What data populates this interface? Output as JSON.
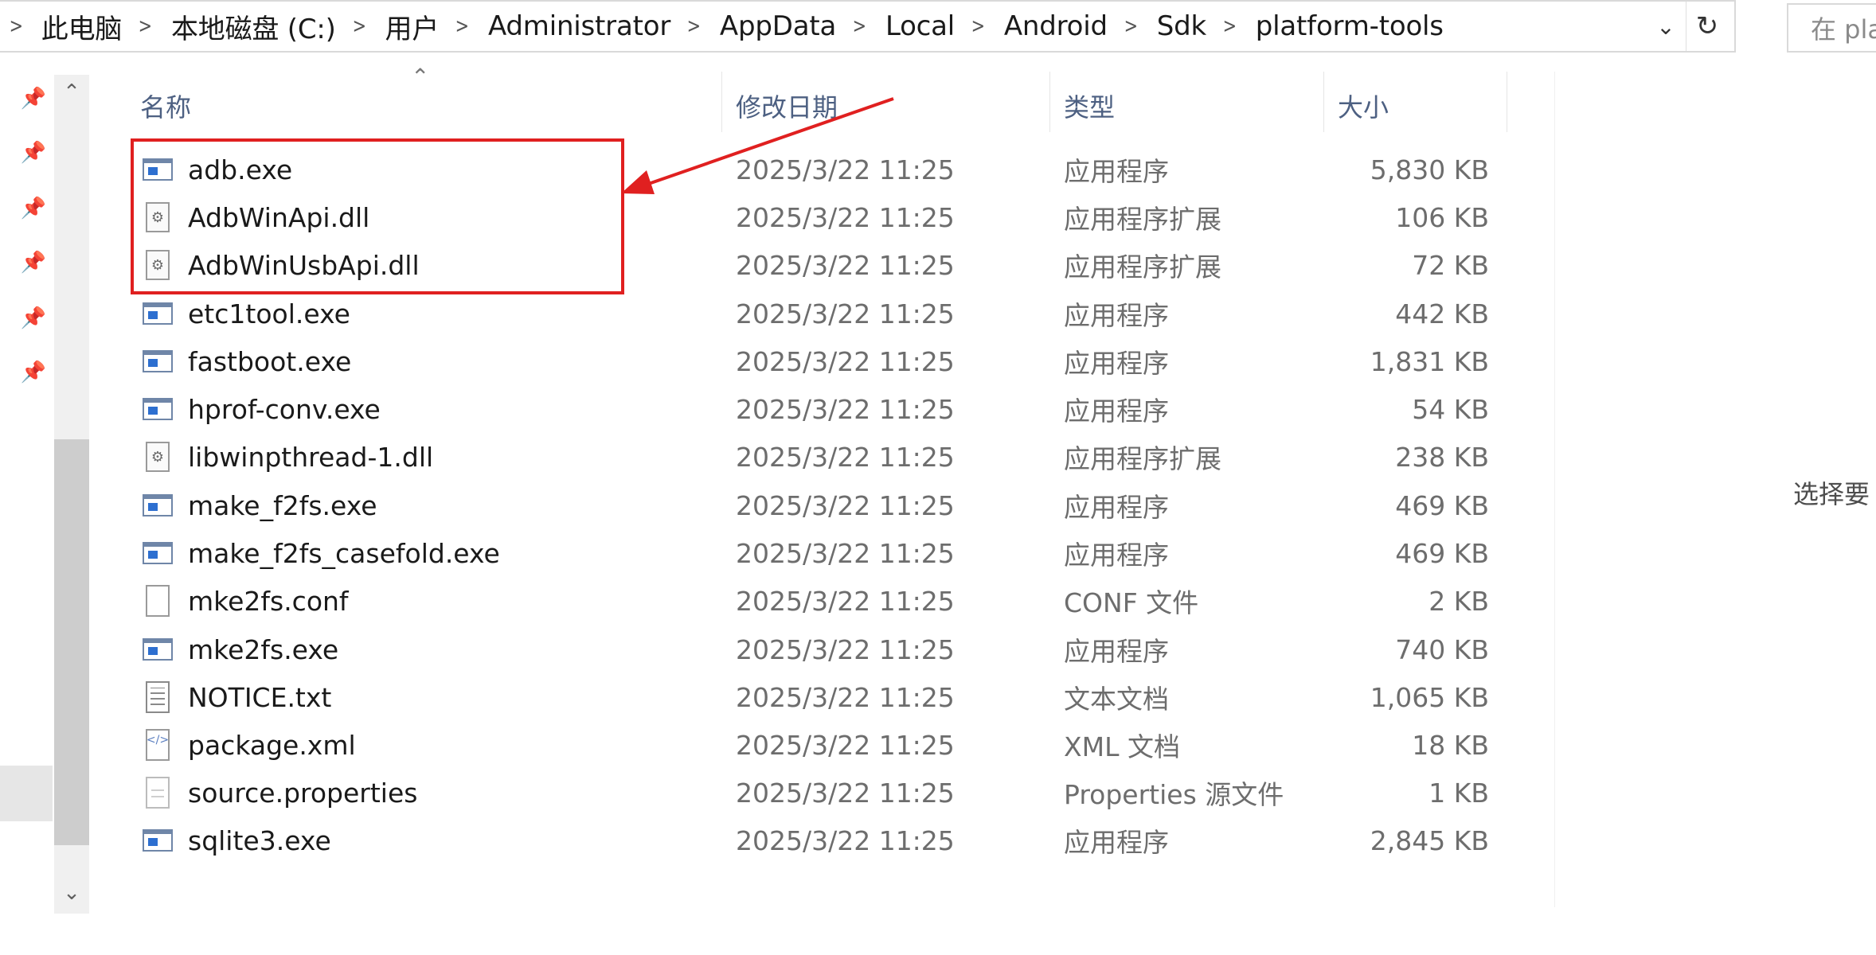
{
  "address_bar": {
    "crumbs": [
      "此电脑",
      "本地磁盘 (C:)",
      "用户",
      "Administrator",
      "AppData",
      "Local",
      "Android",
      "Sdk",
      "platform-tools"
    ]
  },
  "search": {
    "placeholder": "在 pla"
  },
  "columns": {
    "name": "名称",
    "date": "修改日期",
    "type": "类型",
    "size": "大小"
  },
  "files": [
    {
      "name": "adb.exe",
      "date": "2025/3/22 11:25",
      "type": "应用程序",
      "size": "5,830 KB",
      "icon": "exe"
    },
    {
      "name": "AdbWinApi.dll",
      "date": "2025/3/22 11:25",
      "type": "应用程序扩展",
      "size": "106 KB",
      "icon": "dll"
    },
    {
      "name": "AdbWinUsbApi.dll",
      "date": "2025/3/22 11:25",
      "type": "应用程序扩展",
      "size": "72 KB",
      "icon": "dll"
    },
    {
      "name": "etc1tool.exe",
      "date": "2025/3/22 11:25",
      "type": "应用程序",
      "size": "442 KB",
      "icon": "exe"
    },
    {
      "name": "fastboot.exe",
      "date": "2025/3/22 11:25",
      "type": "应用程序",
      "size": "1,831 KB",
      "icon": "exe"
    },
    {
      "name": "hprof-conv.exe",
      "date": "2025/3/22 11:25",
      "type": "应用程序",
      "size": "54 KB",
      "icon": "exe"
    },
    {
      "name": "libwinpthread-1.dll",
      "date": "2025/3/22 11:25",
      "type": "应用程序扩展",
      "size": "238 KB",
      "icon": "dll"
    },
    {
      "name": "make_f2fs.exe",
      "date": "2025/3/22 11:25",
      "type": "应用程序",
      "size": "469 KB",
      "icon": "exe"
    },
    {
      "name": "make_f2fs_casefold.exe",
      "date": "2025/3/22 11:25",
      "type": "应用程序",
      "size": "469 KB",
      "icon": "exe"
    },
    {
      "name": "mke2fs.conf",
      "date": "2025/3/22 11:25",
      "type": "CONF 文件",
      "size": "2 KB",
      "icon": "doc"
    },
    {
      "name": "mke2fs.exe",
      "date": "2025/3/22 11:25",
      "type": "应用程序",
      "size": "740 KB",
      "icon": "exe"
    },
    {
      "name": "NOTICE.txt",
      "date": "2025/3/22 11:25",
      "type": "文本文档",
      "size": "1,065 KB",
      "icon": "txt"
    },
    {
      "name": "package.xml",
      "date": "2025/3/22 11:25",
      "type": "XML 文档",
      "size": "18 KB",
      "icon": "xml"
    },
    {
      "name": "source.properties",
      "date": "2025/3/22 11:25",
      "type": "Properties 源文件",
      "size": "1 KB",
      "icon": "prop"
    },
    {
      "name": "sqlite3.exe",
      "date": "2025/3/22 11:25",
      "type": "应用程序",
      "size": "2,845 KB",
      "icon": "exe"
    }
  ],
  "details_pane": {
    "text": "选择要"
  },
  "annotation": {
    "color": "#e02020",
    "highlighted_files": [
      "adb.exe",
      "AdbWinApi.dll",
      "AdbWinUsbApi.dll"
    ]
  }
}
